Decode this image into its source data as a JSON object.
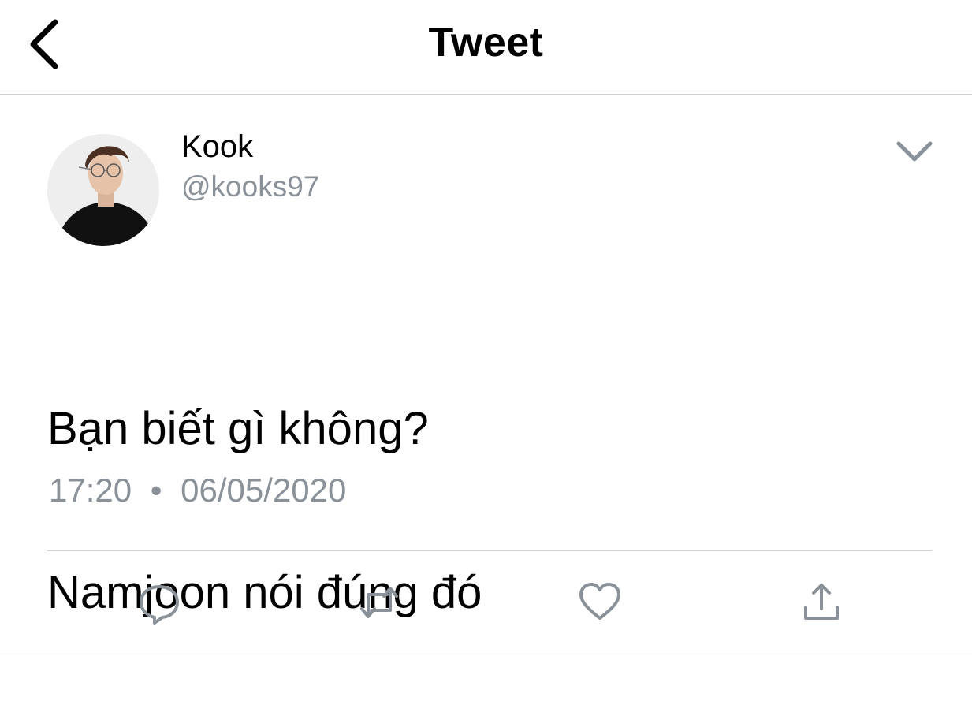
{
  "header": {
    "title": "Tweet",
    "back_icon": "chevron-left-icon"
  },
  "author": {
    "name": "Kook",
    "handle": "@kooks97",
    "avatar": "profile-photo"
  },
  "tweet": {
    "lines": [
      "Bạn biết gì không?",
      "Namjoon nói đúng đó"
    ],
    "time": "17:20",
    "separator": "•",
    "date": "06/05/2020"
  },
  "actions": {
    "reply_icon": "reply-icon",
    "retweet_icon": "retweet-icon",
    "like_icon": "heart-icon",
    "share_icon": "share-icon"
  },
  "colors": {
    "icon_gray": "#8a9199",
    "divider": "#cfd3d6",
    "text": "#000000"
  }
}
